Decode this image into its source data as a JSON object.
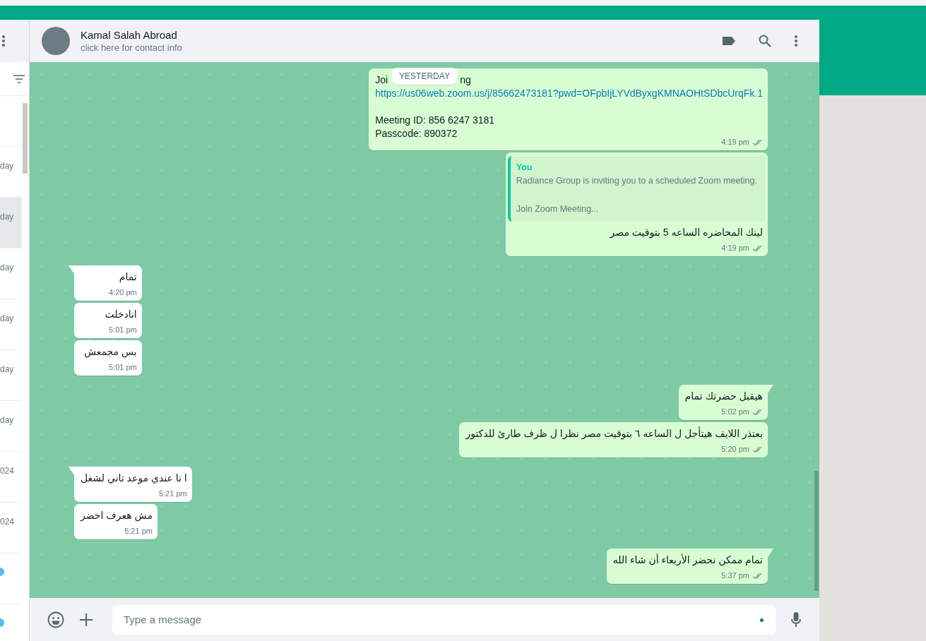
{
  "sidebar": {
    "chats": [
      {
        "kind": "blank",
        "selected": false
      },
      {
        "kind": "time",
        "time": "day",
        "selected": false
      },
      {
        "kind": "time",
        "time": "day",
        "selected": true
      },
      {
        "kind": "time",
        "time": "day",
        "selected": false
      },
      {
        "kind": "time",
        "time": "day",
        "selected": false
      },
      {
        "kind": "time",
        "time": "day",
        "selected": false
      },
      {
        "kind": "time",
        "time": "day",
        "selected": false
      },
      {
        "kind": "time",
        "time": "024",
        "selected": false
      },
      {
        "kind": "time",
        "time": "024",
        "selected": false
      },
      {
        "kind": "icon",
        "selected": false
      },
      {
        "kind": "icon",
        "selected": false
      }
    ]
  },
  "contact": {
    "name": "Kamal Salah Abroad",
    "subtitle": "click here for contact info"
  },
  "date_chip": "YESTERDAY",
  "messages": [
    {
      "outgoing": true,
      "tail": false,
      "read": false,
      "time": "4:19 pm",
      "lines": [
        {
          "kind": "covered",
          "parts": [
            "Joi",
            "ng"
          ]
        },
        {
          "kind": "link",
          "text": "https://us06web.zoom.us/j/85662473181?pwd=OFpbIjLYVdByxgKMNAOHtSDbcUrqFk.1"
        },
        {
          "kind": "blank"
        },
        {
          "kind": "text",
          "text": "Meeting ID: 856 6247 3181"
        },
        {
          "kind": "text",
          "text": "Passcode: 890372"
        }
      ]
    },
    {
      "outgoing": true,
      "tail": false,
      "read": false,
      "time": "4:19 pm",
      "quote": {
        "author": "You",
        "text": "Radiance Group is inviting you to a scheduled Zoom meeting.\n\nJoin Zoom Meeting..."
      },
      "lines": [
        {
          "kind": "text",
          "text": "لينك المحاضره الساعه 5 بتوقيت مصر"
        }
      ]
    },
    {
      "outgoing": false,
      "tail": true,
      "time": "4:20 pm",
      "lines": [
        {
          "kind": "text",
          "text": "تمام"
        }
      ]
    },
    {
      "outgoing": false,
      "tail": false,
      "time": "5:01 pm",
      "lines": [
        {
          "kind": "text",
          "text": "انادخلت"
        }
      ]
    },
    {
      "outgoing": false,
      "tail": false,
      "time": "5:01 pm",
      "lines": [
        {
          "kind": "text",
          "text": "بس مجمعش"
        }
      ]
    },
    {
      "outgoing": true,
      "tail": true,
      "read": false,
      "time": "5:02 pm",
      "lines": [
        {
          "kind": "text",
          "text": "هيقبل حضرتك تمام"
        }
      ]
    },
    {
      "outgoing": true,
      "tail": false,
      "read": false,
      "time": "5:20 pm",
      "lines": [
        {
          "kind": "text",
          "text": "بعتذر اللايف هيتأجل ل الساعه ٦ بتوقيت مصر نظرا ل ظرف طارئ للدكتور"
        }
      ]
    },
    {
      "outgoing": false,
      "tail": true,
      "time": "5:21 pm",
      "lines": [
        {
          "kind": "text",
          "text": "ا نا عندي موعد تاني لشغل"
        }
      ]
    },
    {
      "outgoing": false,
      "tail": false,
      "time": "5:21 pm",
      "lines": [
        {
          "kind": "text",
          "text": "مش هعرف احضر"
        }
      ]
    },
    {
      "outgoing": true,
      "tail": true,
      "read": false,
      "time": "5:37 pm",
      "lines": [
        {
          "kind": "text",
          "text": "تمام ممكن نحضر الأربعاء أن شاء الله"
        }
      ]
    }
  ],
  "composer": {
    "placeholder": "Type a message"
  }
}
